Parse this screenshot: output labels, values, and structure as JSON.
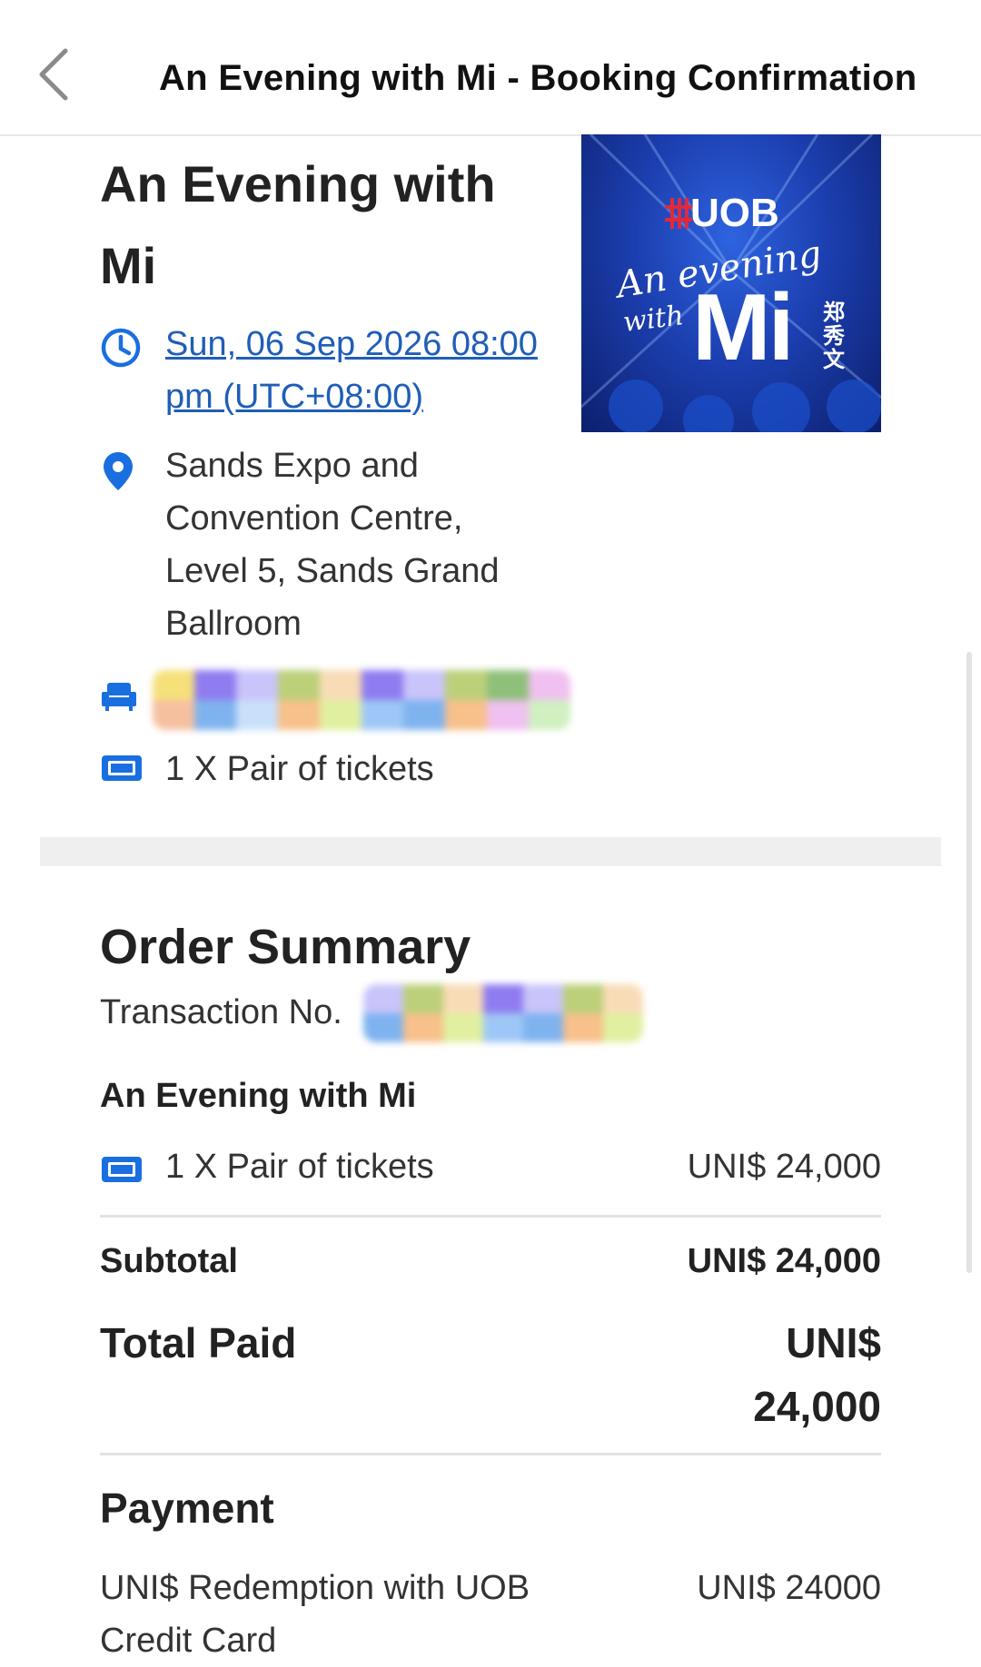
{
  "header": {
    "title": "An Evening with Mi - Booking Confirmation",
    "back_icon": "chevron-left-icon"
  },
  "event": {
    "title": "An Evening with Mi",
    "datetime": "Sun, 06 Sep 2026 08:00 pm (UTC+08:00)",
    "venue": "Sands Expo and Convention Centre, Level 5, Sands Grand Ballroom",
    "tickets": "1 X Pair of tickets",
    "poster": {
      "brand": "UOB",
      "line1": "An evening",
      "line2": "with",
      "name": "Mi",
      "chinese": "郑秀文"
    }
  },
  "order_summary": {
    "title": "Order Summary",
    "transaction_label": "Transaction No.",
    "item_name": "An Evening with Mi",
    "item_line": "1 X Pair of tickets",
    "item_price": "UNI$ 24,000",
    "subtotal_label": "Subtotal",
    "subtotal_value": "UNI$ 24,000",
    "total_label": "Total Paid",
    "total_value_line1": "UNI$",
    "total_value_line2": "24,000"
  },
  "payment": {
    "title": "Payment",
    "method": "UNI$ Redemption with UOB Credit Card",
    "amount": "UNI$ 24000"
  },
  "colors": {
    "accent": "#1f5eb8",
    "icon_blue": "#1a6fe0",
    "divider": "#efefef",
    "poster_blue": "#1c3fb0"
  }
}
